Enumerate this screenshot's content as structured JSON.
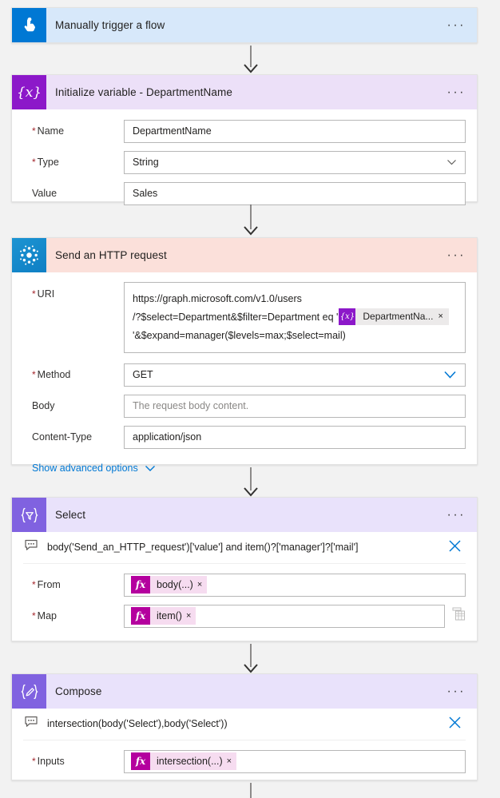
{
  "flow": {
    "steps": [
      {
        "id": "trigger",
        "title": "Manually trigger a flow",
        "icon": "tap-hand-icon",
        "more_label": "···"
      },
      {
        "id": "init-variable",
        "title": "Initialize variable - DepartmentName",
        "icon": "variable-braces-icon",
        "more_label": "···",
        "fields": [
          {
            "label": "Name",
            "required": true,
            "value": "DepartmentName"
          },
          {
            "label": "Type",
            "required": true,
            "value": "String",
            "control": "dropdown"
          },
          {
            "label": "Value",
            "required": false,
            "value": "Sales"
          }
        ]
      },
      {
        "id": "send-http-request",
        "title": "Send an HTTP request",
        "icon": "graph-burst-icon",
        "more_label": "···",
        "uri": {
          "label": "URI",
          "required": true,
          "line1": "https://graph.microsoft.com/v1.0/users",
          "line2_before": "/?$select=Department&$filter=Department eq '",
          "token": {
            "label": "DepartmentNa...",
            "badge": "{x}",
            "remove": "×"
          },
          "line3": "'&$expand=manager($levels=max;$select=mail)"
        },
        "fields": [
          {
            "label": "Method",
            "required": true,
            "value": "GET",
            "control": "dropdown"
          },
          {
            "label": "Body",
            "required": false,
            "placeholder": "The request body content."
          },
          {
            "label": "Content-Type",
            "required": false,
            "value": "application/json"
          }
        ],
        "advanced_label": "Show advanced options"
      },
      {
        "id": "select",
        "title": "Select",
        "icon": "filter-braces-icon",
        "more_label": "···",
        "comment": {
          "text": "body('Send_an_HTTP_request')['value'] and item()?['manager']?['mail']",
          "icon": "comment-icon",
          "close": "close-icon"
        },
        "fields": [
          {
            "label": "From",
            "required": true,
            "token": {
              "badge": "fx",
              "text": "body(...)",
              "remove": "×"
            }
          },
          {
            "label": "Map",
            "required": true,
            "token": {
              "badge": "fx",
              "text": "item()",
              "remove": "×"
            },
            "trailing_icon": "grid-view-icon"
          }
        ]
      },
      {
        "id": "compose",
        "title": "Compose",
        "icon": "compose-braces-icon",
        "more_label": "···",
        "comment": {
          "text": "intersection(body('Select'),body('Select'))",
          "icon": "comment-icon",
          "close": "close-icon"
        },
        "fields": [
          {
            "label": "Inputs",
            "required": true,
            "token": {
              "badge": "fx",
              "text": "intersection(...)",
              "remove": "×"
            }
          }
        ]
      }
    ],
    "colors": {
      "trigger_header": "#d7e8fa",
      "trigger_icon": "#0078d4",
      "variable_header": "#ece0f8",
      "variable_icon": "#8c18c9",
      "http_header": "#fbe0da",
      "http_icon": "#0f7fc4",
      "data_header": "#e9e2fb",
      "data_icon": "#8062e0",
      "required_star": "#a4262c",
      "link": "#0078d4",
      "fx_badge": "#b4009e"
    }
  }
}
